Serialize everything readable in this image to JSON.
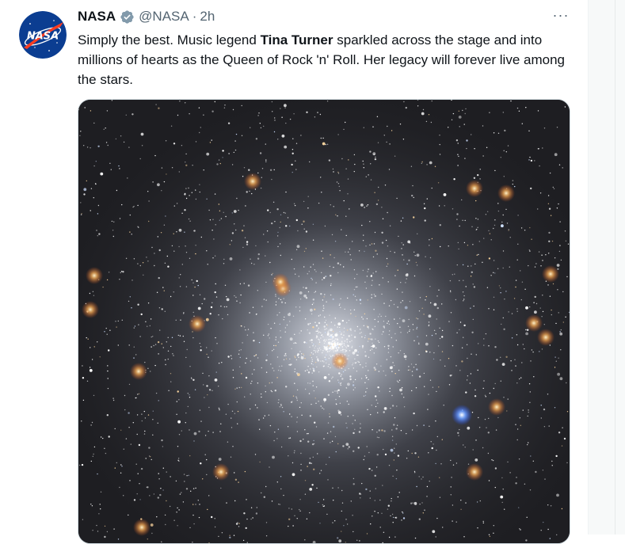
{
  "tweet": {
    "display_name": "NASA",
    "handle": "@NASA",
    "separator": "·",
    "time": "2h",
    "more_label": "···",
    "text_before": "Simply the best. Music legend ",
    "text_bold": "Tina Turner",
    "text_after": " sparkled across the stage and into millions of hearts as the Queen of Rock 'n' Roll. Her legacy will forever live among the stars.",
    "avatar_logo_text": "NASA"
  },
  "colors": {
    "nasa_blue": "#0b3d91",
    "nasa_red": "#fc3d21",
    "verified_badge": "#829aab",
    "secondary_text": "#536471"
  },
  "icons": {
    "verified": "verified-badge-icon",
    "more": "more-options-icon"
  },
  "media": {
    "subject": "globular star cluster"
  }
}
